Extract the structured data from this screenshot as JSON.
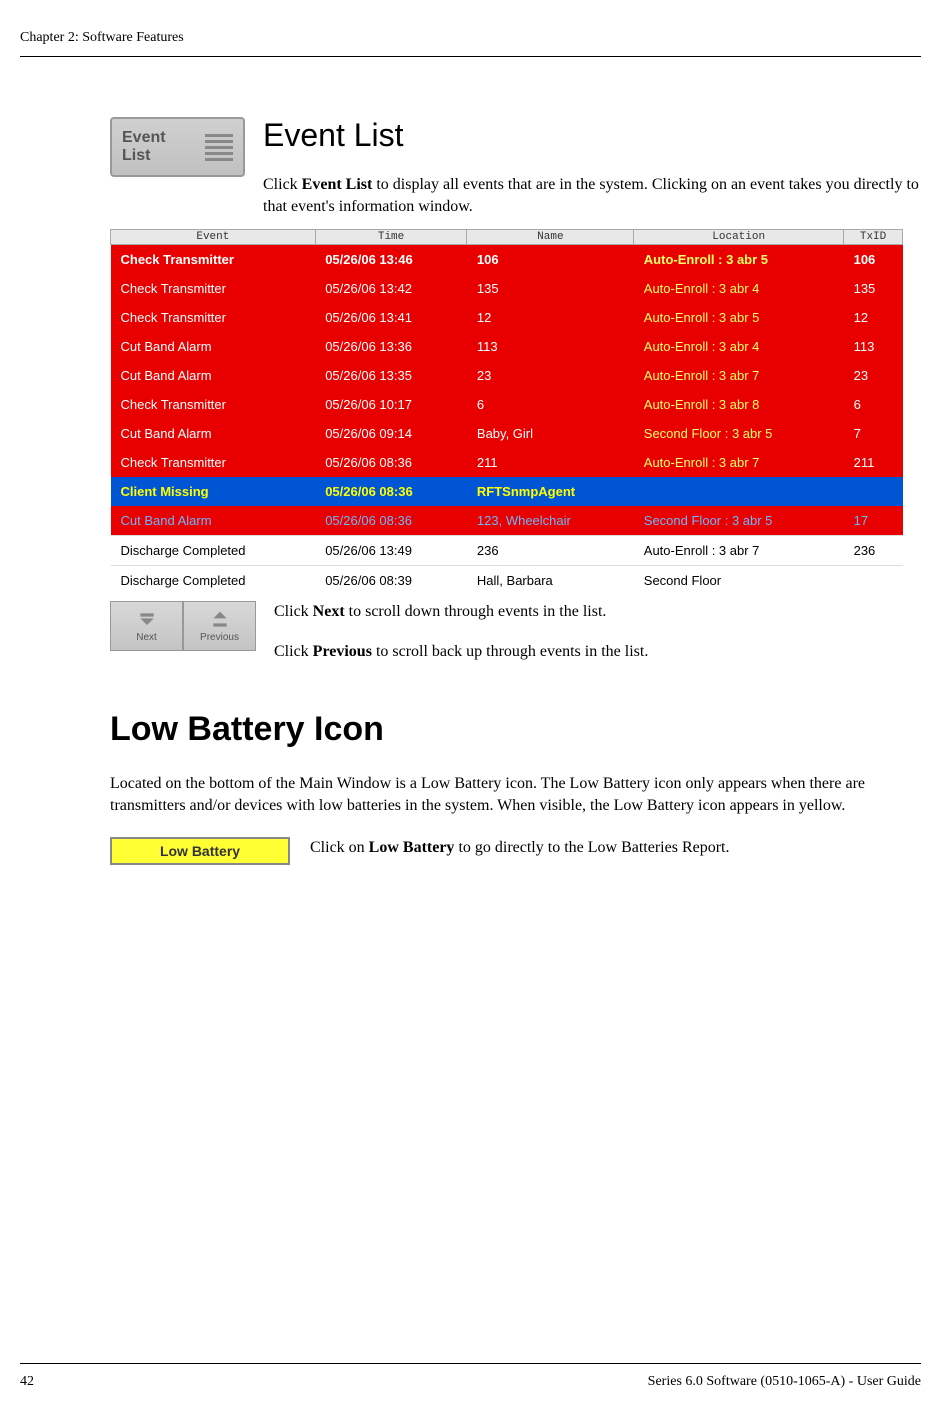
{
  "header": {
    "chapter": "Chapter 2: Software Features"
  },
  "event_list_button": {
    "line1": "Event",
    "line2": "List"
  },
  "section": {
    "title": "Event List",
    "intro_a": "Click ",
    "intro_bold": "Event List",
    "intro_b": " to display all events that are in the system. Clicking on an event takes you directly to that event's information window."
  },
  "table": {
    "headers": [
      "Event",
      "Time",
      "Name",
      "Location",
      "TxID"
    ],
    "rows": [
      {
        "style": "red bold",
        "cells": [
          "Check Transmitter",
          "05/26/06 13:46",
          "106",
          "Auto-Enroll : 3 abr 5",
          "106"
        ]
      },
      {
        "style": "red",
        "cells": [
          "Check Transmitter",
          "05/26/06 13:42",
          "135",
          "Auto-Enroll : 3 abr 4",
          "135"
        ]
      },
      {
        "style": "red",
        "cells": [
          "Check Transmitter",
          "05/26/06 13:41",
          "12",
          "Auto-Enroll : 3 abr 5",
          "12"
        ]
      },
      {
        "style": "red",
        "cells": [
          "Cut Band Alarm",
          "05/26/06 13:36",
          "113",
          "Auto-Enroll : 3 abr 4",
          "113"
        ]
      },
      {
        "style": "red",
        "cells": [
          "Cut Band Alarm",
          "05/26/06 13:35",
          "23",
          "Auto-Enroll : 3 abr 7",
          "23"
        ]
      },
      {
        "style": "red",
        "cells": [
          "Check Transmitter",
          "05/26/06 10:17",
          "6",
          "Auto-Enroll : 3 abr 8",
          "6"
        ]
      },
      {
        "style": "red",
        "cells": [
          "Cut Band Alarm",
          "05/26/06 09:14",
          "Baby, Girl",
          "Second Floor : 3 abr 5",
          "7"
        ]
      },
      {
        "style": "red",
        "cells": [
          "Check Transmitter",
          "05/26/06 08:36",
          "211",
          "Auto-Enroll : 3 abr 7",
          "211"
        ]
      },
      {
        "style": "blue",
        "cells": [
          "Client Missing",
          "05/26/06 08:36",
          "RFTSnmpAgent",
          "",
          ""
        ]
      },
      {
        "style": "redblue",
        "cells": [
          "Cut Band Alarm",
          "05/26/06 08:36",
          "123, Wheelchair",
          "Second Floor : 3 abr 5",
          "17"
        ]
      },
      {
        "style": "white",
        "cells": [
          "Discharge Completed",
          "05/26/06 13:49",
          "236",
          "Auto-Enroll : 3 abr 7",
          "236"
        ]
      },
      {
        "style": "white",
        "cells": [
          "Discharge Completed",
          "05/26/06 08:39",
          "Hall, Barbara",
          "Second Floor",
          ""
        ]
      }
    ]
  },
  "nav": {
    "next_label": "Next",
    "prev_label": "Previous",
    "next_text_a": "Click ",
    "next_text_bold": "Next",
    "next_text_b": " to scroll down through events in the list.",
    "prev_text_a": "Click ",
    "prev_text_bold": "Previous",
    "prev_text_b": " to scroll back up through events in the list."
  },
  "low_battery": {
    "heading": "Low Battery Icon",
    "para": "Located on the bottom of the Main Window is a Low Battery icon. The Low Battery icon only appears when there are transmitters and/or devices with low batteries in the system. When visible, the Low Battery icon appears in yellow.",
    "button_label": "Low Battery",
    "click_a": "Click on ",
    "click_bold": "Low Battery",
    "click_b": " to go directly to the Low Batteries Report."
  },
  "footer": {
    "page": "42",
    "doc": "Series 6.0 Software (0510-1065-A) - User Guide"
  }
}
